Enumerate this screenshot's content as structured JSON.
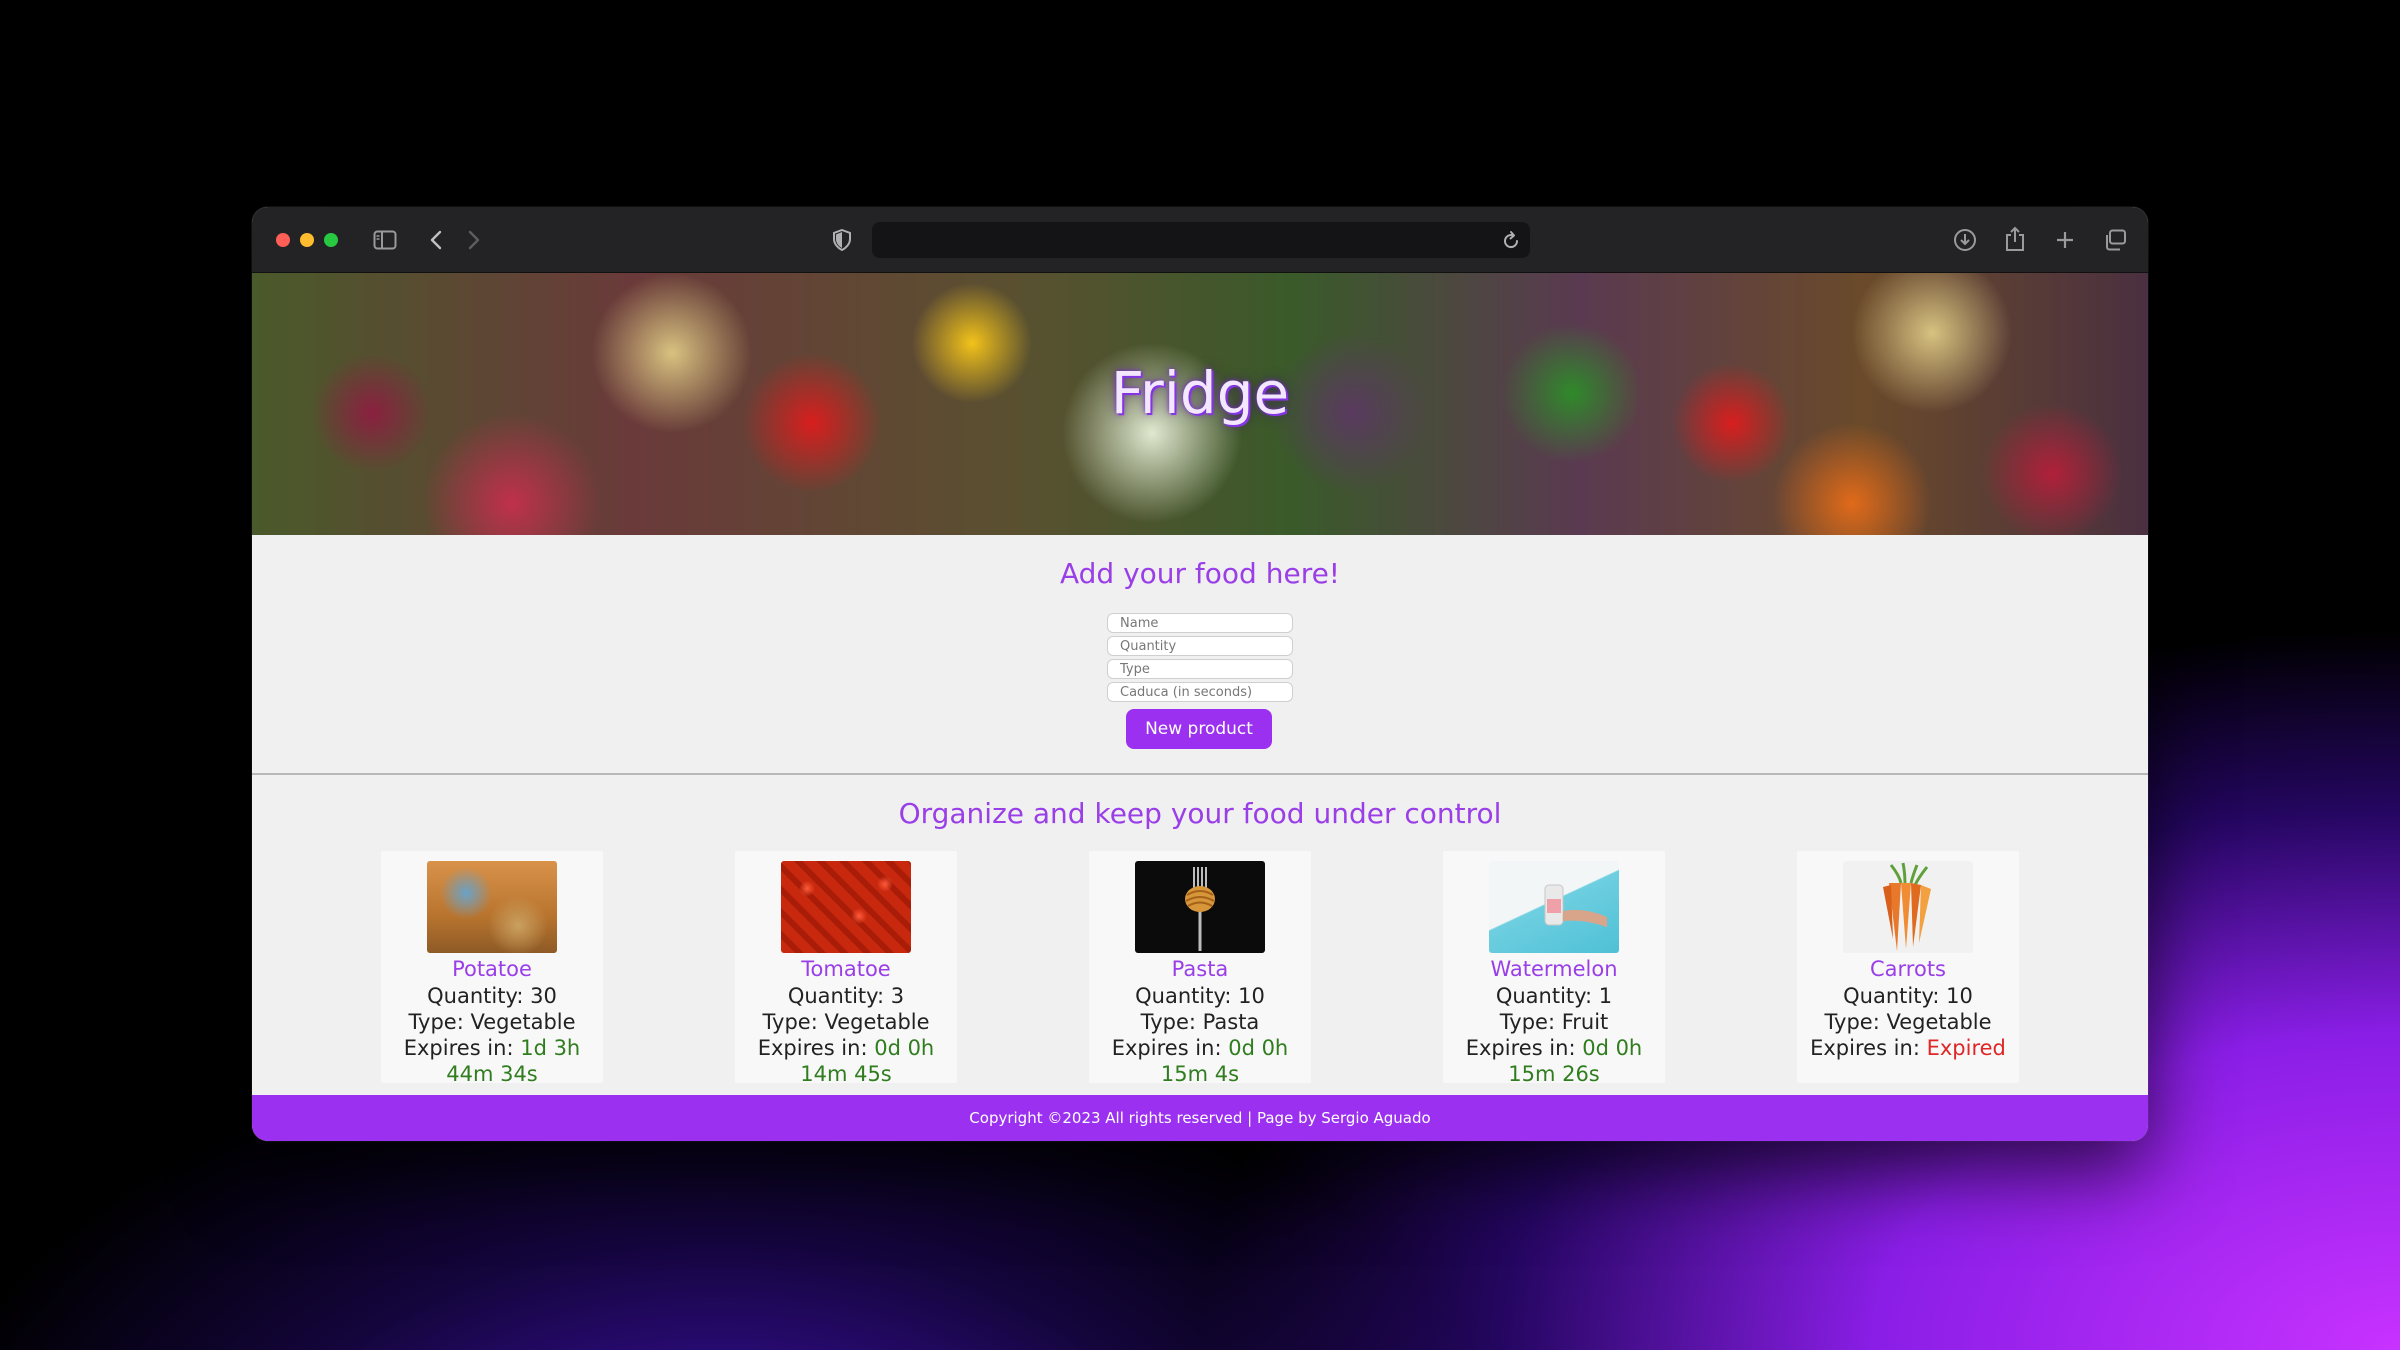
{
  "hero": {
    "title": "Fridge"
  },
  "add_form": {
    "heading": "Add your food here!",
    "name_placeholder": "Name",
    "quantity_placeholder": "Quantity",
    "type_placeholder": "Type",
    "expiry_placeholder": "Caduca (in seconds)",
    "submit_label": "New product"
  },
  "list": {
    "heading": "Organize and keep your food under control",
    "quantity_label": "Quantity: ",
    "type_label": "Type: ",
    "expires_label": "Expires in: ",
    "items": [
      {
        "name": "Potatoe",
        "quantity": "30",
        "type": "Vegetable",
        "expires_part1": "1d 3h",
        "expires_part2": "44m 34s",
        "status": "ok"
      },
      {
        "name": "Tomatoe",
        "quantity": "3",
        "type": "Vegetable",
        "expires_part1": "0d 0h",
        "expires_part2": "14m 45s",
        "status": "ok"
      },
      {
        "name": "Pasta",
        "quantity": "10",
        "type": "Pasta",
        "expires_part1": "0d 0h",
        "expires_part2": "15m 4s",
        "status": "ok"
      },
      {
        "name": "Watermelon",
        "quantity": "1",
        "type": "Fruit",
        "expires_part1": "0d 0h",
        "expires_part2": "15m 26s",
        "status": "ok"
      },
      {
        "name": "Carrots",
        "quantity": "10",
        "type": "Vegetable",
        "expires_part1": "Expired",
        "expires_part2": "",
        "status": "expired"
      }
    ]
  },
  "footer": {
    "text": "Copyright ©2023 All rights reserved | Page by Sergio Aguado"
  },
  "colors": {
    "accent": "#9b30f0",
    "heading": "#9a3ee8",
    "ok": "#2f7d1e",
    "expired": "#e02626"
  },
  "icons": [
    "sidebar-icon",
    "back-icon",
    "forward-icon",
    "shield-icon",
    "reload-icon",
    "download-icon",
    "share-icon",
    "new-tab-icon",
    "tabs-overview-icon"
  ]
}
